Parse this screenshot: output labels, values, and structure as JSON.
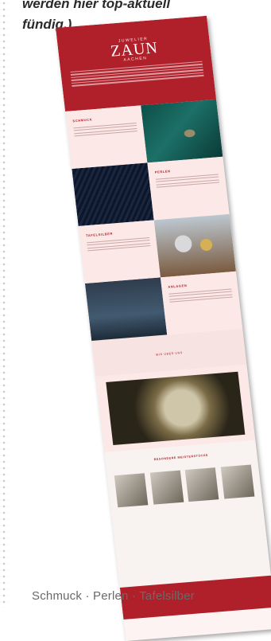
{
  "intro": {
    "line1": "werden hier top-aktuell",
    "line2": "fündig.)"
  },
  "site": {
    "brand_small": "JUWELIER",
    "brand": "ZAUN",
    "brand_city": "AACHEN",
    "sections": {
      "schmuck": "SCHMUCK",
      "perlen": "PERLEN",
      "tafelsilber": "TAFELSILBER",
      "anlagen": "ANLAGEN",
      "coin": "WIR ÜBER UNS",
      "best": "BESONDERE MEISTERSTÜCKE"
    }
  },
  "caption": "Schmuck · Perlen · Tafelsilber",
  "colors": {
    "brand_red": "#b0202a",
    "panel_pink": "#fbe8e7"
  }
}
